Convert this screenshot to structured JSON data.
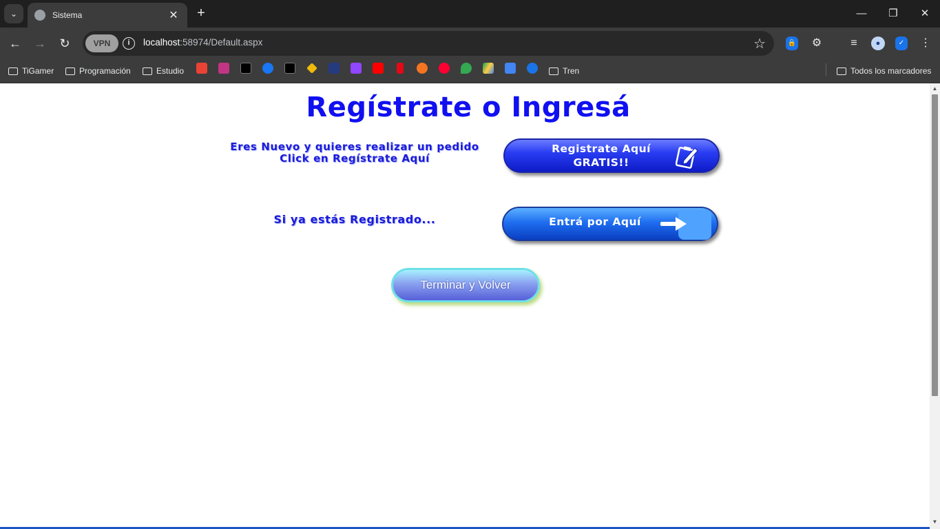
{
  "browser": {
    "tab_title": "Sistema",
    "url_host": "localhost",
    "url_rest": ":58974/Default.aspx",
    "vpn_label": "VPN",
    "bookmarks": [
      "TiGamer",
      "Programación",
      "Estudio",
      "Tren"
    ],
    "all_bookmarks_label": "Todos los marcadores"
  },
  "page": {
    "title": "Regístrate o Ingresá",
    "new_user_line1": "Eres Nuevo y quieres realizar un pedido",
    "new_user_line2": "Click en Regístrate Aquí",
    "register_button_line1": "Registrate Aquí",
    "register_button_line2": "GRATIS!!",
    "registered_label": "Si ya estás Registrado...",
    "enter_button": "Entrá por Aquí",
    "finish_button": "Terminar y Volver"
  },
  "colors": {
    "title": "#1010f0",
    "browser_dark": "#3c3c3c"
  }
}
